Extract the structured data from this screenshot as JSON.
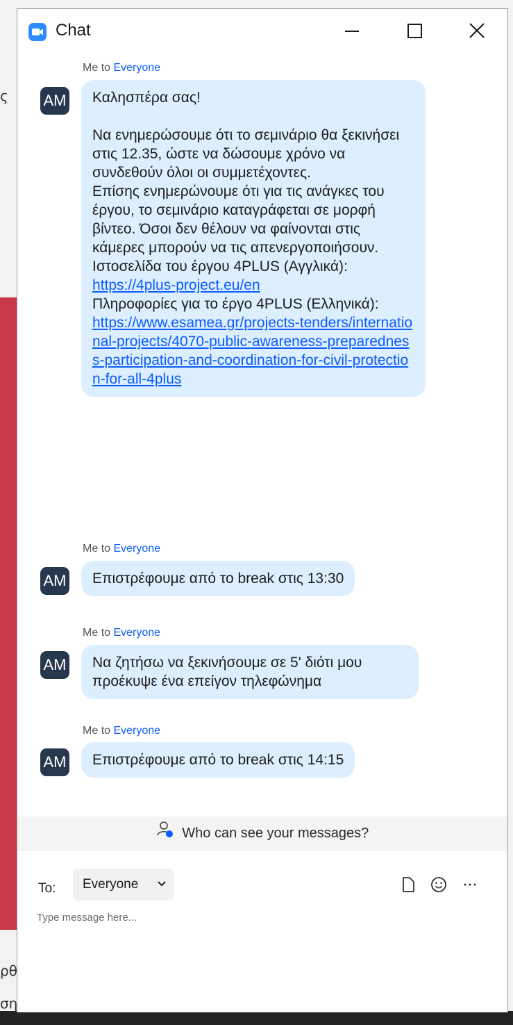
{
  "window": {
    "title": "Chat",
    "accent_color": "#2d8cff"
  },
  "background_app": {
    "fragments": [
      "ς",
      "ς",
      "ς",
      "ρθ",
      "ση"
    ]
  },
  "messages": [
    {
      "sender": "Me",
      "connector": "to",
      "recipient": "Everyone",
      "avatar": "AM",
      "lines": [
        "Καλησπέρα σας!",
        "",
        "Να ενημερώσουμε ότι το σεμινάριο θα ξεκινήσει στις 12.35, ώστε να δώσουμε χρόνο να συνδεθούν όλοι οι συμμετέχοντες.",
        "Επίσης ενημερώνουμε ότι για τις ανάγκες του έργου, το σεμινάριο καταγράφεται σε μορφή βίντεο. Όσοι δεν θέλουν να φαίνονται στις κάμερες μπορούν να τις απενεργοποιήσουν.",
        "Ιστοσελίδα του έργου 4PLUS (Αγγλικά):"
      ],
      "link1": "https://4plus-project.eu/en",
      "line_after_link1": "Πληροφορίες για το έργο 4PLUS (Ελληνικά):",
      "link2": "https://www.esamea.gr/projects-tenders/international-projects/4070-public-awareness-preparedness-participation-and-coordination-for-civil-protection-for-all-4plus"
    },
    {
      "sender": "Me",
      "connector": "to",
      "recipient": "Everyone",
      "avatar": "AM",
      "text": "Επιστρέφουμε από το break στις 13:30"
    },
    {
      "sender": "Me",
      "connector": "to",
      "recipient": "Everyone",
      "avatar": "AM",
      "text": "Να ζητήσω να ξεκινήσουμε σε 5' διότι μου προέκυψε ένα επείγον τηλεφώνημα"
    },
    {
      "sender": "Me",
      "connector": "to",
      "recipient": "Everyone",
      "avatar": "AM",
      "text": "Επιστρέφουμε από το break στις 14:15"
    }
  ],
  "privacy": {
    "text": "Who can see your messages?"
  },
  "composer": {
    "to_label": "To:",
    "recipient": "Everyone",
    "placeholder": "Type message here...",
    "value": "",
    "icons": [
      "file-icon",
      "emoji-icon",
      "more-icon"
    ]
  }
}
